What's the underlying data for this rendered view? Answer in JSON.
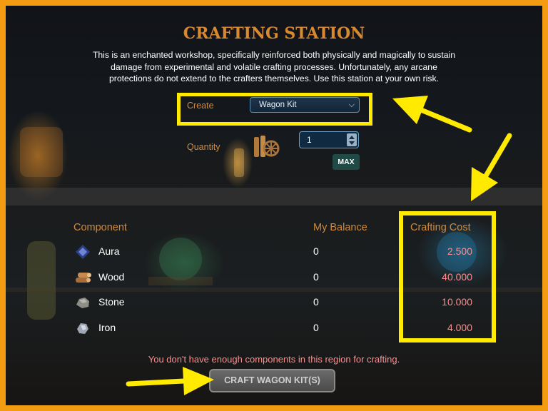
{
  "title": "CRAFTING STATION",
  "description": "This is an enchanted workshop, specifically reinforced both physically and magically to sustain damage from experimental and volatile crafting processes. Unfortunately, any arcane protections do not extend to the crafters themselves. Use this station at your own risk.",
  "create": {
    "label": "Create",
    "selected": "Wagon Kit"
  },
  "quantity": {
    "label": "Quantity",
    "value": "1",
    "max_label": "MAX",
    "item_icon": "wagon-kit-icon"
  },
  "table": {
    "headers": {
      "component": "Component",
      "balance": "My Balance",
      "cost": "Crafting Cost"
    },
    "rows": [
      {
        "icon": "aura-icon",
        "name": "Aura",
        "balance": "0",
        "cost": "2.500"
      },
      {
        "icon": "wood-icon",
        "name": "Wood",
        "balance": "0",
        "cost": "40.000"
      },
      {
        "icon": "stone-icon",
        "name": "Stone",
        "balance": "0",
        "cost": "10.000"
      },
      {
        "icon": "iron-icon",
        "name": "Iron",
        "balance": "0",
        "cost": "4.000"
      }
    ]
  },
  "warning": "You don't have enough components in this region for crafting.",
  "craft_button": "CRAFT WAGON KIT(S)",
  "colors": {
    "frame_border": "#f39c12",
    "highlight": "#ffea00",
    "title": "#d8882e",
    "label": "#d28a3a",
    "cost_text": "#ff8c8c",
    "max_button": "#1f4a45"
  }
}
